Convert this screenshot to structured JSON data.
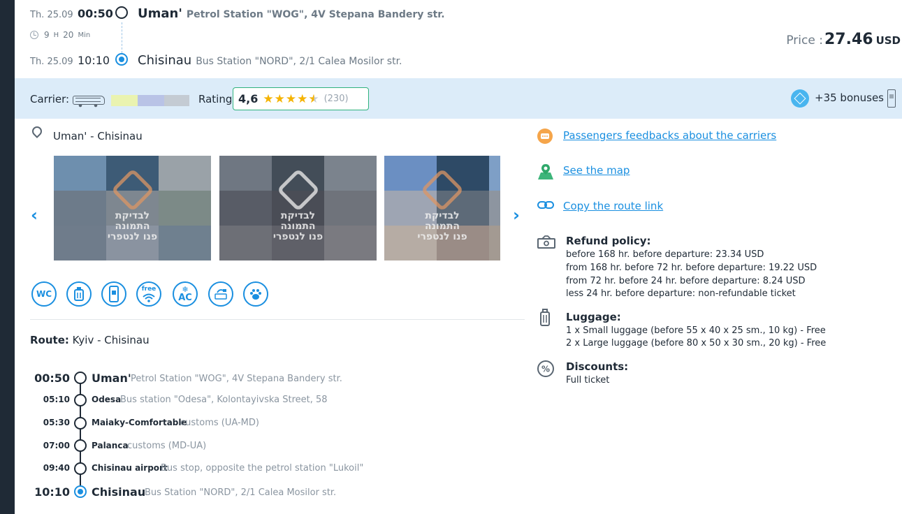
{
  "departure": {
    "date": "Th. 25.09",
    "time": "00:50",
    "city": "Uman'",
    "address": "Petrol Station \"WOG\", 4V Stepana Bandery str."
  },
  "duration": {
    "hours": "9",
    "hours_unit": "H",
    "minutes": "20",
    "minutes_unit": "Min"
  },
  "arrival": {
    "date": "Th. 25.09",
    "time": "10:10",
    "city": "Chisinau",
    "address": "Bus Station \"NORD\", 2/1 Calea Mosilor str."
  },
  "price": {
    "label": "Price :",
    "value": "27.46",
    "currency": "USD"
  },
  "carrier": {
    "label": "Carrier:",
    "rating_label": "Rating:",
    "rating": "4,6",
    "rating_count": "(230)",
    "stars_full": 4,
    "stars_half": 1,
    "bonuses": "+35 bonuses"
  },
  "location": "Uman' - Chisinau",
  "photo_watermark": {
    "line1": "לבדיקת",
    "line2": "התמונה",
    "line3": "פנו לנטפרי"
  },
  "features": [
    {
      "name": "wc-icon",
      "label": "WC"
    },
    {
      "name": "usb-charger-icon",
      "label": ""
    },
    {
      "name": "e-ticket-phone-icon",
      "label": ""
    },
    {
      "name": "free-wifi-icon",
      "label": "free"
    },
    {
      "name": "air-conditioning-icon",
      "label": "AC"
    },
    {
      "name": "power-socket-icon",
      "label": ""
    },
    {
      "name": "pets-allowed-icon",
      "label": ""
    }
  ],
  "route": {
    "label": "Route:",
    "value": "Kyiv - Chisinau"
  },
  "stops": [
    {
      "time": "00:50",
      "city": "Uman'",
      "address": "Petrol Station \"WOG\", 4V Stepana Bandery str."
    },
    {
      "time": "05:10",
      "city": "Odesa",
      "address": "Bus station \"Odesa\", Kolontayivska Street, 58"
    },
    {
      "time": "05:30",
      "city": "Maiaky-Comfortable",
      "address": "customs (UA-MD)"
    },
    {
      "time": "07:00",
      "city": "Palanca",
      "address": "customs (MD-UA)"
    },
    {
      "time": "09:40",
      "city": "Chisinau airport",
      "address": "Bus stop, opposite the petrol station \"Lukoil\""
    },
    {
      "time": "10:10",
      "city": "Chisinau",
      "address": "Bus Station \"NORD\", 2/1 Calea Mosilor str."
    }
  ],
  "side": {
    "feedbacks": "Passengers feedbacks about the carriers",
    "map": "See the map",
    "copy_link": "Copy the route link",
    "refund_title": "Refund policy:",
    "refund_lines": [
      "before 168 hr. before departure: 23.34 USD",
      "from 168 hr. before 72 hr. before departure: 19.22 USD",
      "from 72 hr. before 24 hr. before departure: 8.24 USD",
      "less 24 hr. before departure: non-refundable ticket"
    ],
    "luggage_title": "Luggage:",
    "luggage_lines": [
      "1 x Small luggage (before 55 x 40 x 25 sm., 10 kg) - Free",
      "2 x Large luggage (before 80 x 50 x 30 sm., 20 kg) - Free"
    ],
    "discounts_title": "Discounts:",
    "discounts_value": "Full ticket"
  }
}
